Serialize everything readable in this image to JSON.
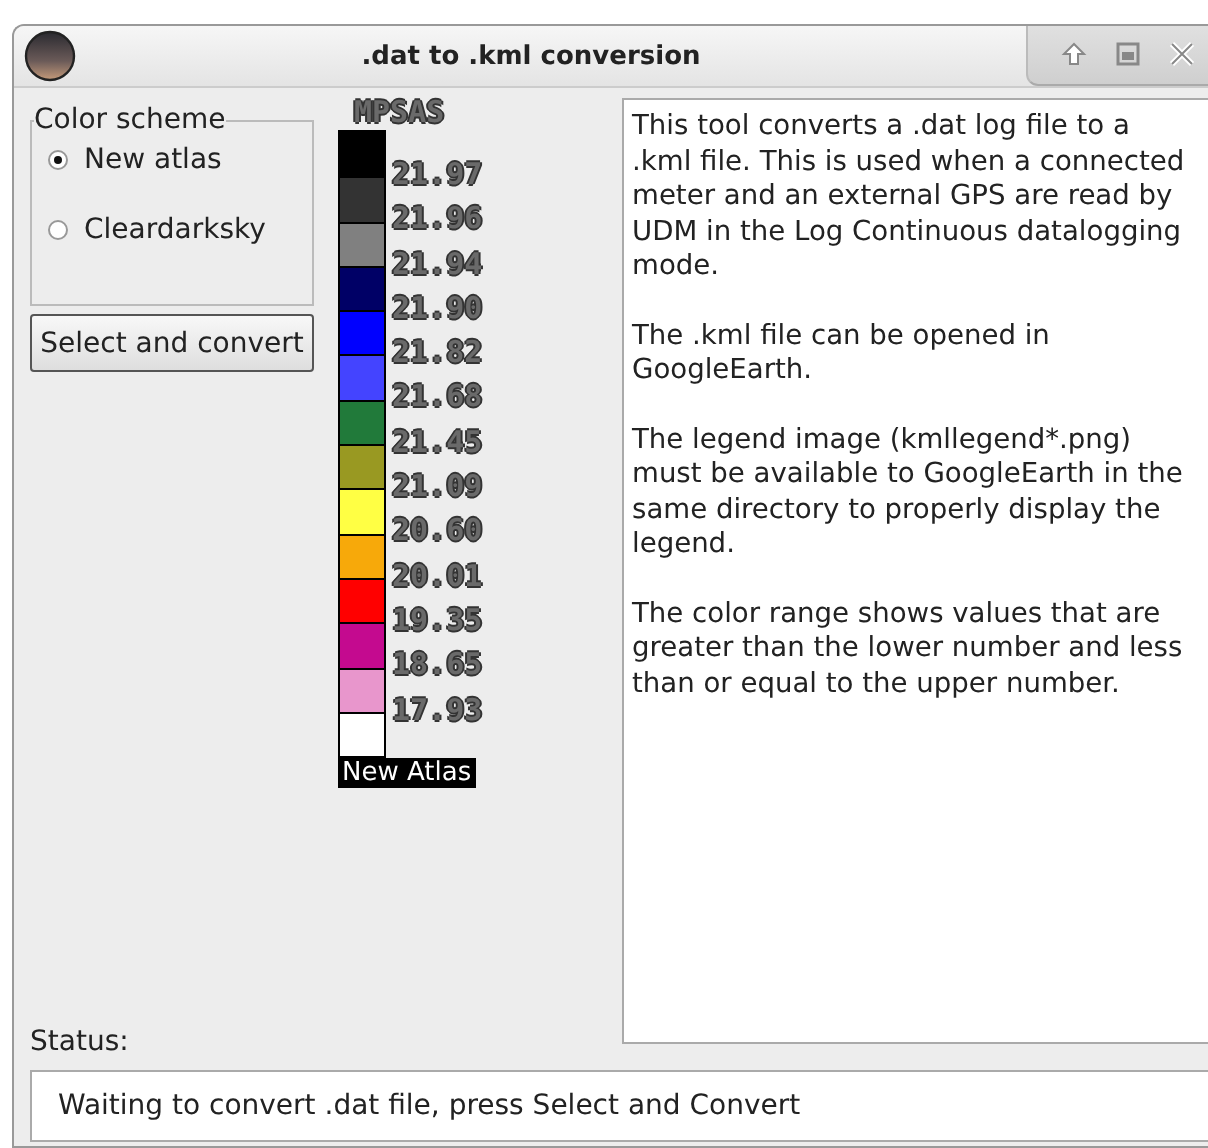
{
  "window": {
    "title": ".dat to .kml conversion"
  },
  "color_scheme": {
    "title": "Color scheme",
    "options": [
      {
        "label": "New atlas",
        "selected": true
      },
      {
        "label": "Cleardarksky",
        "selected": false
      }
    ]
  },
  "convert_button": "Select and convert",
  "legend": {
    "title": "MPSAS",
    "caption": "New Atlas",
    "swatches": [
      {
        "color": "#000000"
      },
      {
        "color": "#333333"
      },
      {
        "color": "#808080"
      },
      {
        "color": "#000066"
      },
      {
        "color": "#0000ff"
      },
      {
        "color": "#4444ff"
      },
      {
        "color": "#217a3a"
      },
      {
        "color": "#999922"
      },
      {
        "color": "#ffff44"
      },
      {
        "color": "#f7a90a"
      },
      {
        "color": "#ff0000"
      },
      {
        "color": "#c40a8f"
      },
      {
        "color": "#e896cc"
      },
      {
        "color": "#ffffff"
      }
    ],
    "labels": [
      "21.97",
      "21.96",
      "21.94",
      "21.90",
      "21.82",
      "21.68",
      "21.45",
      "21.09",
      "20.60",
      "20.01",
      "19.35",
      "18.65",
      "17.93"
    ]
  },
  "info_text": [
    "This tool converts a .dat log file to a .kml file. This is used when a connected meter and an external GPS are read by UDM in the Log Continuous datalogging mode.",
    "The .kml file can be opened in GoogleEarth.",
    "The legend image (kmllegend*.png) must be available to GoogleEarth in the same directory to properly display the legend.",
    "The color range shows values that are greater than the lower number and less than or equal to the upper number."
  ],
  "status": {
    "label": "Status:",
    "value": "Waiting to convert .dat file, press Select and Convert"
  }
}
